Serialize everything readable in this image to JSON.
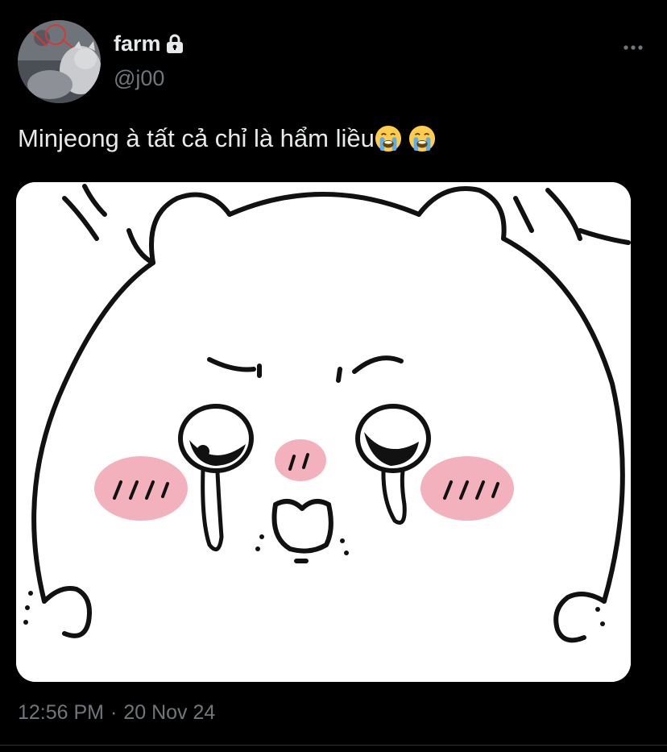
{
  "user": {
    "display_name": "farm",
    "handle": "@j00",
    "verified_icon": "lock-icon",
    "avatar_icon": "avatar-image"
  },
  "tweet": {
    "text": "Minjeong à tất cả chỉ là hẩm liều",
    "emojis": [
      "loudly-crying-face",
      "loudly-crying-face"
    ],
    "media_description": "crying-bear-illustration"
  },
  "meta": {
    "time": "12:56 PM",
    "separator": "·",
    "date": "20 Nov 24"
  },
  "menu": {
    "more_icon": "more-horizontal-icon"
  },
  "colors": {
    "background": "#000000",
    "text_primary": "#e7e9ea",
    "text_secondary": "#71767b",
    "divider": "#2f3336",
    "blush": "#f3b1bd"
  }
}
